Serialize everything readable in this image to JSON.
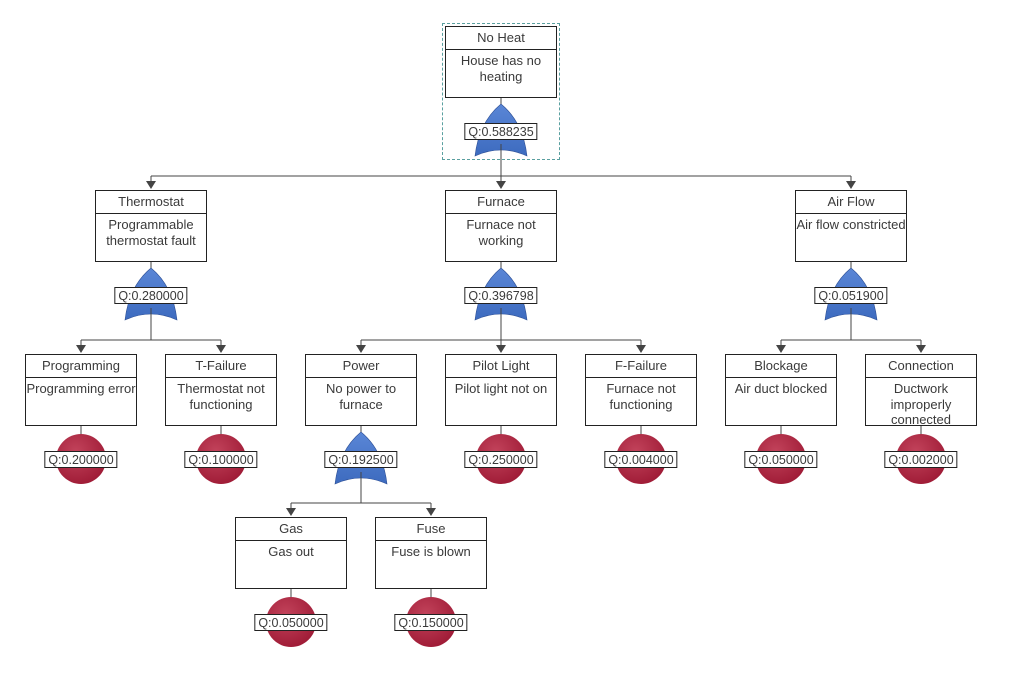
{
  "diagram": {
    "type": "fault-tree",
    "colors": {
      "or_gate": "#3d6bbf",
      "basic_event": "#9e1a35",
      "line": "#444444",
      "selection": "#5aa0a0"
    },
    "nodes": [
      {
        "id": "top",
        "title": "No Heat",
        "desc": "House has no heating",
        "gate": "or",
        "q": "Q:0.588235",
        "selected": true
      },
      {
        "id": "thermostat",
        "title": "Thermostat",
        "desc": "Programmable thermostat fault",
        "gate": "or",
        "q": "Q:0.280000",
        "parent": "top"
      },
      {
        "id": "furnace",
        "title": "Furnace",
        "desc": "Furnace not working",
        "gate": "or",
        "q": "Q:0.396798",
        "parent": "top"
      },
      {
        "id": "airflow",
        "title": "Air Flow",
        "desc": "Air flow constricted",
        "gate": "or",
        "q": "Q:0.051900",
        "parent": "top"
      },
      {
        "id": "programming",
        "title": "Programming",
        "desc": "Programming error",
        "gate": "basic",
        "q": "Q:0.200000",
        "parent": "thermostat"
      },
      {
        "id": "tfailure",
        "title": "T-Failure",
        "desc": "Thermostat not functioning",
        "gate": "basic",
        "q": "Q:0.100000",
        "parent": "thermostat"
      },
      {
        "id": "power",
        "title": "Power",
        "desc": "No power to furnace",
        "gate": "or",
        "q": "Q:0.192500",
        "parent": "furnace"
      },
      {
        "id": "pilot",
        "title": "Pilot Light",
        "desc": "Pilot light not on",
        "gate": "basic",
        "q": "Q:0.250000",
        "parent": "furnace"
      },
      {
        "id": "ffailure",
        "title": "F-Failure",
        "desc": "Furnace not functioning",
        "gate": "basic",
        "q": "Q:0.004000",
        "parent": "furnace"
      },
      {
        "id": "blockage",
        "title": "Blockage",
        "desc": "Air duct blocked",
        "gate": "basic",
        "q": "Q:0.050000",
        "parent": "airflow"
      },
      {
        "id": "connection",
        "title": "Connection",
        "desc": "Ductwork improperly connected",
        "gate": "basic",
        "q": "Q:0.002000",
        "parent": "airflow"
      },
      {
        "id": "gas",
        "title": "Gas",
        "desc": "Gas out",
        "gate": "basic",
        "q": "Q:0.050000",
        "parent": "power"
      },
      {
        "id": "fuse",
        "title": "Fuse",
        "desc": "Fuse is blown",
        "gate": "basic",
        "q": "Q:0.150000",
        "parent": "power"
      }
    ]
  }
}
